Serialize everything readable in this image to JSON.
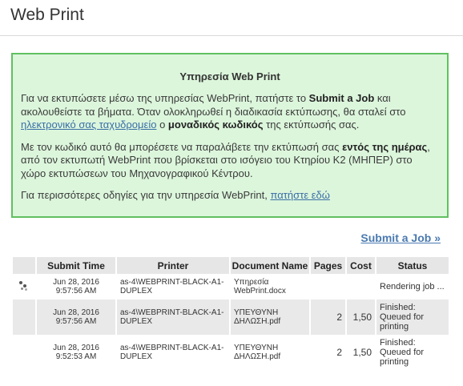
{
  "page": {
    "title": "Web Print"
  },
  "info": {
    "heading": "Υπηρεσία Web Print",
    "p1_before": "Για να εκτυπώσετε μέσω της υπηρεσίας WebPrint, πατήστε το ",
    "p1_submit_bold": "Submit a Job",
    "p1_mid": " και ακολουθείστε τα βήματα. Όταν ολοκληρωθεί η διαδικασία εκτύπωσης, θα σταλεί στο ",
    "p1_link": "ηλεκτρονικό σας ταχυδρομείο",
    "p1_space": " ο ",
    "p1_code_bold": "μοναδικός κωδικός",
    "p1_after": " της εκτύπωσής σας.",
    "p2_before": "Με τον κωδικό αυτό θα μπορέσετε να παραλάβετε την εκτύπωσή σας ",
    "p2_bold": "εντός της ημέρας",
    "p2_after": ", από τον εκτυπωτή WebPrint που βρίσκεται στο ισόγειο του Κτηρίου Κ2 (ΜΗΠΕΡ) στο χώρο εκτυπώσεων του Μηχανογραφικού Κέντρου.",
    "p3_before": "Για περισσότερες οδηγίες για την υπηρεσία WebPrint, ",
    "p3_link": "πατήστε εδώ"
  },
  "submit_link": "Submit a Job »",
  "table": {
    "headers": [
      "",
      "Submit Time",
      "Printer",
      "Document Name",
      "Pages",
      "Cost",
      "Status"
    ],
    "rows": [
      {
        "icon": "spinner-icon",
        "time": "Jun 28, 2016 9:57:56 AM",
        "printer": "as-4\\WEBPRINT-BLACK-A1-DUPLEX",
        "document": "Υπηρεσία WebPrint.docx",
        "pages": "",
        "cost": "",
        "status": "Rendering job ..."
      },
      {
        "icon": "",
        "time": "Jun 28, 2016 9:57:56 AM",
        "printer": "as-4\\WEBPRINT-BLACK-A1-DUPLEX",
        "document": "ΥΠΕΥΘΥΝΗ ΔΗΛΩΣΗ.pdf",
        "pages": "2",
        "cost": "1,50",
        "status": "Finished: Queued for printing"
      },
      {
        "icon": "",
        "time": "Jun 28, 2016 9:52:53 AM",
        "printer": "as-4\\WEBPRINT-BLACK-A1-DUPLEX",
        "document": "ΥΠΕΥΘΥΝΗ ΔΗΛΩΣΗ.pdf",
        "pages": "2",
        "cost": "1,50",
        "status": "Finished: Queued for printing"
      }
    ]
  },
  "colors": {
    "info_bg": "#dcf6dc",
    "info_border": "#60c060",
    "link": "#4a7ab0",
    "header_bg": "#e6e6e6"
  }
}
